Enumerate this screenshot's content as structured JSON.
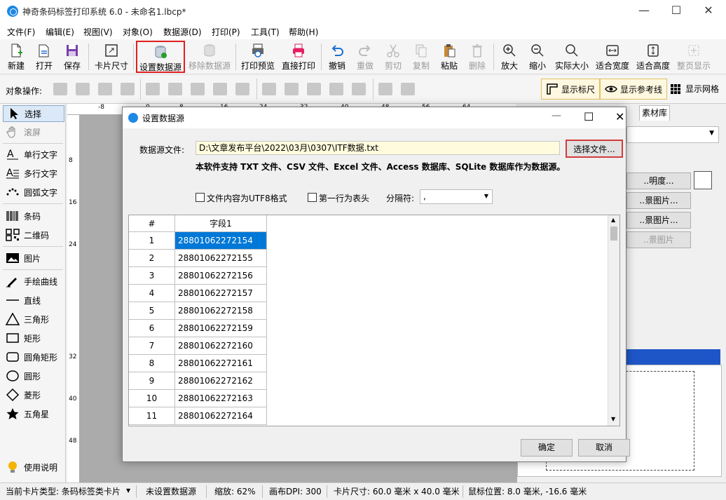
{
  "window": {
    "title": "神奇条码标签打印系统 6.0 - 未命名1.lbcp*"
  },
  "menu": [
    "文件(F)",
    "编辑(E)",
    "视图(V)",
    "对象(O)",
    "数据源(D)",
    "打印(P)",
    "工具(T)",
    "帮助(H)"
  ],
  "toolbar": {
    "new": "新建",
    "open": "打开",
    "save": "保存",
    "card_size": "卡片尺寸",
    "set_datasource": "设置数据源",
    "remove_datasource": "移除数据源",
    "print_preview": "打印预览",
    "direct_print": "直接打印",
    "undo": "撤销",
    "redo": "重做",
    "cut": "剪切",
    "copy": "复制",
    "paste": "粘贴",
    "delete": "删除",
    "zoom_in": "放大",
    "zoom_out": "缩小",
    "actual_size": "实际大小",
    "fit_width": "适合宽度",
    "fit_height": "适合高度",
    "page_display": "整页显示"
  },
  "toolbar2": {
    "label": "对象操作:",
    "show_ruler": "显示标尺",
    "show_guides": "显示参考线",
    "show_grid": "显示网格"
  },
  "tools": {
    "select": "选择",
    "scroll": "滚屏",
    "single_text": "单行文字",
    "multi_text": "多行文字",
    "arc_text": "圆弧文字",
    "barcode": "条码",
    "qrcode": "二维码",
    "image": "图片",
    "freehand": "手绘曲线",
    "line": "直线",
    "triangle": "三角形",
    "rect": "矩形",
    "round_rect": "圆角矩形",
    "ellipse": "圆形",
    "diamond": "菱形",
    "star": "五角星",
    "help": "使用说明"
  },
  "ruler": {
    "top": [
      "-8",
      "0",
      "8",
      "16",
      "24",
      "32",
      "40",
      "48",
      "56",
      "64"
    ],
    "left": [
      "8",
      "16",
      "24",
      "32",
      "40",
      "48"
    ]
  },
  "rightpanel": {
    "tab": "素材库",
    "btn_transparency": "..明度...",
    "btn_bg1": "..景图片...",
    "btn_bg2": "..景图片...",
    "btn_bg3": "..景图片"
  },
  "dialog": {
    "title": "设置数据源",
    "file_label": "数据源文件:",
    "file_path": "D:\\文章发布平台\\2022\\03月\\0307\\ITF数据.txt",
    "choose_file": "选择文件...",
    "support_note": "本软件支持 TXT 文件、CSV 文件、Excel 文件、Access 数据库、SQLite 数据库作为数据源。",
    "utf8_label": "文件内容为UTF8格式",
    "header_label": "第一行为表头",
    "separator_label": "分隔符:",
    "separator_value": ",",
    "ok": "确定",
    "cancel": "取消",
    "grid": {
      "headers": [
        "#",
        "字段1"
      ],
      "rows": [
        [
          "1",
          "28801062272154"
        ],
        [
          "2",
          "28801062272155"
        ],
        [
          "3",
          "28801062272156"
        ],
        [
          "4",
          "28801062272157"
        ],
        [
          "5",
          "28801062272158"
        ],
        [
          "6",
          "28801062272159"
        ],
        [
          "7",
          "28801062272160"
        ],
        [
          "8",
          "28801062272161"
        ],
        [
          "9",
          "28801062272162"
        ],
        [
          "10",
          "28801062272163"
        ],
        [
          "11",
          "28801062272164"
        ]
      ]
    }
  },
  "status": {
    "card_type": "当前卡片类型: 条码标签类卡片",
    "datasource": "未设置数据源",
    "zoom": "缩放: 62%",
    "dpi": "画布DPI: 300",
    "card_size": "卡片尺寸: 60.0 毫米 x 40.0 毫米",
    "mouse": "鼠标位置: 8.0 毫米, -16.6 毫米"
  }
}
